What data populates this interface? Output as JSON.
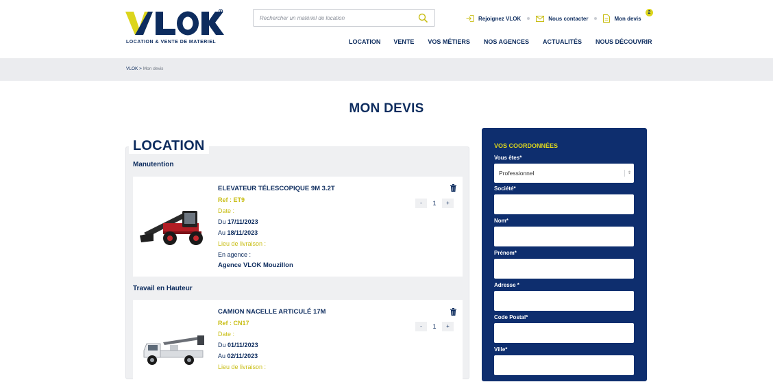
{
  "brand": {
    "tagline": "LOCATION & VENTE DE MATERIEL",
    "colors": {
      "navy": "#0d2c5e",
      "yellow": "#dcd51c",
      "form_bg": "#0e2e6e"
    }
  },
  "search": {
    "placeholder": "Rechercher un matériel de location",
    "icon": "search-icon"
  },
  "toplinks": {
    "join": "Rejoignez VLOK",
    "contact": "Nous contacter",
    "quote": "Mon devis",
    "quote_count": "2"
  },
  "nav": {
    "location": "LOCATION",
    "vente": "VENTE",
    "metiers": "VOS MÉTIERS",
    "agences": "NOS AGENCES",
    "actualites": "ACTUALITÉS",
    "decouvrir": "NOUS DÉCOUVRIR"
  },
  "breadcrumb": {
    "home": "VLOK",
    "separator": ">",
    "current": "Mon devis"
  },
  "page_title": "MON DEVIS",
  "location": {
    "title": "LOCATION",
    "groups": [
      {
        "category": "Manutention",
        "item": {
          "name": "ELEVATEUR TÉLESCOPIQUE 9M 3.2T",
          "ref": "Ref : ET9",
          "date_label": "Date :",
          "from_prefix": "Du",
          "from": "17/11/2023",
          "to_prefix": "Au",
          "to": "18/11/2023",
          "delivery_label": "Lieu de livraison :",
          "delivery_mode": "En agence :",
          "agency": "Agence VLOK Mouzillon",
          "qty": "1",
          "minus": "-",
          "plus": "+"
        }
      },
      {
        "category": "Travail en Hauteur",
        "item": {
          "name": "CAMION NACELLE ARTICULÉ 17M",
          "ref": "Ref : CN17",
          "date_label": "Date :",
          "from_prefix": "Du",
          "from": "01/11/2023",
          "to_prefix": "Au",
          "to": "02/11/2023",
          "delivery_label": "Lieu de livraison :",
          "qty": "1",
          "minus": "-",
          "plus": "+"
        }
      }
    ]
  },
  "form": {
    "title": "VOS COORDONNÉES",
    "type_label": "Vous êtes*",
    "type_value": "Professionnel",
    "company_label": "Société*",
    "lastname_label": "Nom*",
    "firstname_label": "Prénom*",
    "address_label": "Adresse *",
    "zip_label": "Code Postal*",
    "city_label": "Ville*"
  }
}
